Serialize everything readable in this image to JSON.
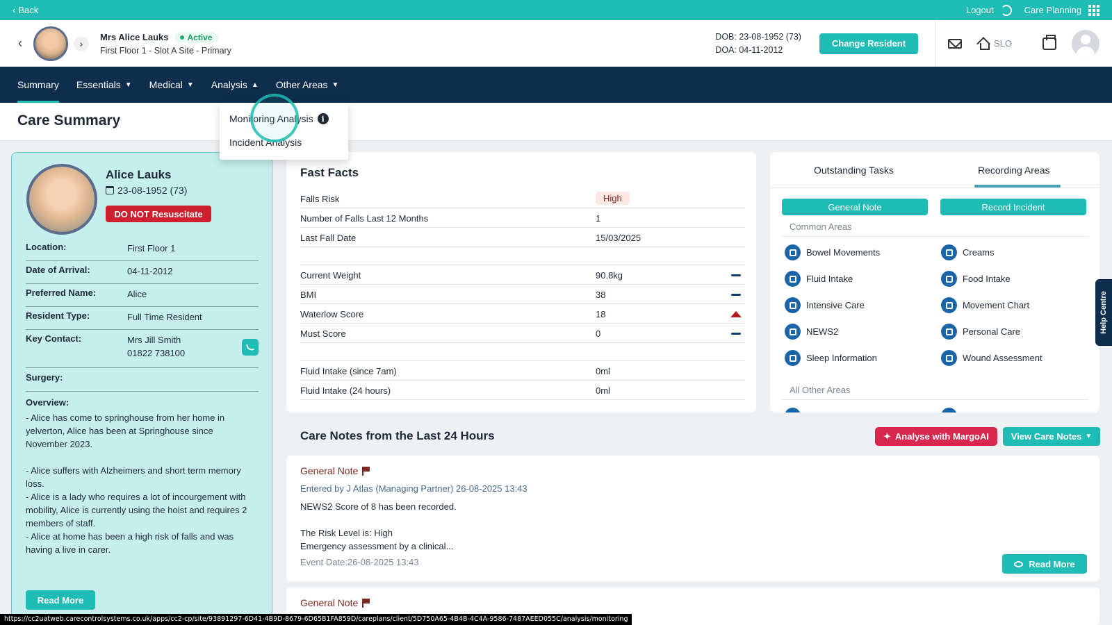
{
  "topbar": {
    "back": "Back",
    "logout": "Logout",
    "care_planning": "Care Planning"
  },
  "resident_header": {
    "name": "Mrs Alice Lauks",
    "status": "Active",
    "location": "First Floor 1 - Slot A Site - Primary",
    "dob": "DOB: 23-08-1952 (73)",
    "doa": "DOA: 04-11-2012",
    "change_resident": "Change Resident",
    "site": "SLO"
  },
  "nav": {
    "items": [
      {
        "label": "Summary"
      },
      {
        "label": "Essentials"
      },
      {
        "label": "Medical"
      },
      {
        "label": "Analysis"
      },
      {
        "label": "Other Areas"
      }
    ]
  },
  "dropdown": {
    "items": [
      {
        "label": "Monitoring Analysis"
      },
      {
        "label": "Incident Analysis"
      }
    ]
  },
  "page_title": "Care Summary",
  "profile": {
    "name": "Alice Lauks",
    "dob": "23-08-1952 (73)",
    "dnr": "DO NOT Resuscitate",
    "rows": [
      {
        "label": "Location:",
        "value": "First Floor 1"
      },
      {
        "label": "Date of Arrival:",
        "value": "04-11-2012"
      },
      {
        "label": "Preferred Name:",
        "value": "Alice"
      },
      {
        "label": "Resident Type:",
        "value": "Full Time Resident"
      },
      {
        "label": "Key Contact:",
        "value": "Mrs Jill Smith",
        "value2": "01822 738100"
      },
      {
        "label": "Surgery:",
        "value": ""
      }
    ],
    "overview_label": "Overview:",
    "overview": [
      "- Alice has come to springhouse from her home in yelverton, Alice has been at Springhouse since November 2023.",
      "- Alice suffers with Alzheimers and short term memory loss.",
      "- Alice is a lady who requires a lot of incourgement with mobility, Alice is currently using the hoist and requires 2 members of staff.",
      "- Alice at home has been a high risk of falls and was having a live in carer."
    ],
    "read_more": "Read More"
  },
  "fast_facts": {
    "title": "Fast Facts",
    "rows": [
      {
        "label": "Falls Risk",
        "value": "High"
      },
      {
        "label": "Number of Falls Last 12 Months",
        "value": "1"
      },
      {
        "label": "Last Fall Date",
        "value": "15/03/2025"
      },
      {
        "label": "Current Weight",
        "value": "90.8kg"
      },
      {
        "label": "BMI",
        "value": "38"
      },
      {
        "label": "Waterlow Score",
        "value": "18"
      },
      {
        "label": "Must Score",
        "value": "0"
      },
      {
        "label": "Fluid Intake (since 7am)",
        "value": "0ml"
      },
      {
        "label": "Fluid Intake (24 hours)",
        "value": "0ml"
      }
    ]
  },
  "right_panel": {
    "tabs": [
      {
        "label": "Outstanding Tasks"
      },
      {
        "label": "Recording Areas"
      }
    ],
    "general_note": "General Note",
    "record_incident": "Record Incident",
    "common_areas_label": "Common Areas",
    "areas": [
      {
        "label": "Bowel Movements"
      },
      {
        "label": "Creams"
      },
      {
        "label": "Fluid Intake"
      },
      {
        "label": "Food Intake"
      },
      {
        "label": "Intensive Care"
      },
      {
        "label": "Movement Chart"
      },
      {
        "label": "NEWS2"
      },
      {
        "label": "Personal Care"
      },
      {
        "label": "Sleep Information"
      },
      {
        "label": "Wound Assessment"
      }
    ],
    "all_other_label": "All Other Areas"
  },
  "help_centre": "Help Centre",
  "care_notes": {
    "title": "Care Notes from the Last 24 Hours",
    "analyse": "Analyse with MargoAI",
    "view": "View Care Notes",
    "notes": [
      {
        "title": "General Note",
        "entered_by": "Entered by J Atlas (Managing Partner) 26-08-2025 13:43",
        "line1": "NEWS2 Score of 8 has been recorded.",
        "line2": "The Risk Level is: High",
        "line3": "Emergency assessment by a clinical...",
        "event_date": "Event Date:26-08-2025 13:43",
        "read_more": "Read More"
      },
      {
        "title": "General Note"
      }
    ]
  },
  "status_url": "https://cc2uatweb.carecontrolsystems.co.uk/apps/cc2-cp/site/93891297-6D41-4B9D-8679-6D65B1FA859D/careplans/client/5D750A65-4B4B-4C4A-9586-7487AEED055C/analysis/monitoring"
}
